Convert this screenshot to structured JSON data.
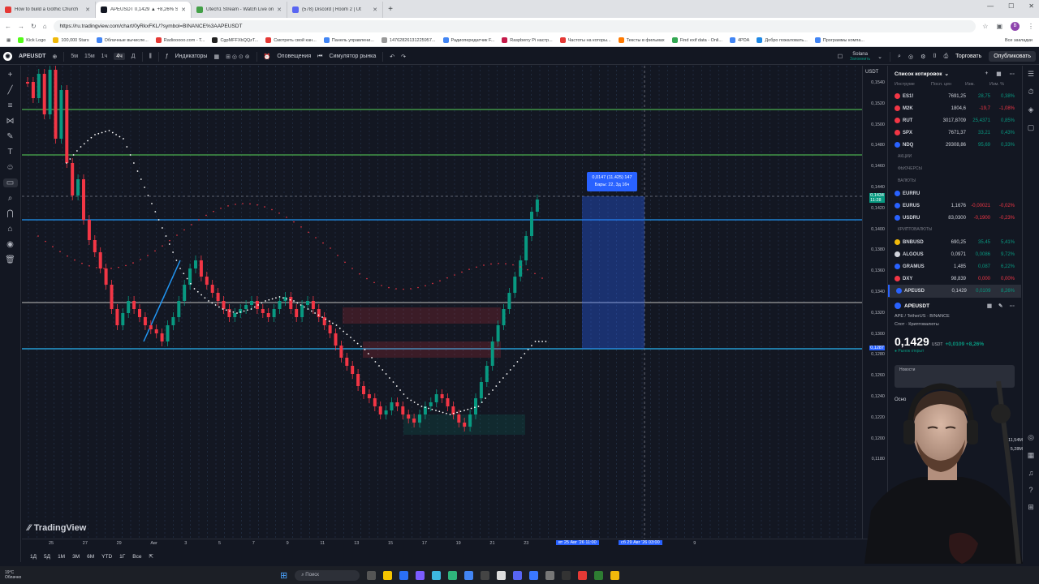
{
  "browser": {
    "tabs": [
      {
        "title": "How to build a Gothic Church",
        "color": "#e53935"
      },
      {
        "title": "APEUSDT 0,1429 ▲ +8,26% Sol",
        "color": "#131722",
        "active": true
      },
      {
        "title": "Utech1 Stream - Watch Live on",
        "color": "#43a047"
      },
      {
        "title": "(578) Discord | Room 2 | Ut",
        "color": "#5865f2"
      }
    ],
    "url": "https://ru.tradingview.com/chart/0yRkxFKL/?symbol=BINANCE%3AAPEUSDT",
    "bookmarks": [
      "Kick Logo",
      "100,000 Stars",
      "Облачные вычисле...",
      "Radiooooo.com - T...",
      "CgpMFFXbQQzT...",
      "Смотреть свой кан...",
      "Панель управлени...",
      "14762826131225957...",
      "Радиопередатчик F...",
      "Raspberry Pi настр...",
      "Частоты на которы...",
      "Тексты в фильмах",
      "Find exif data - Onli...",
      "4PDA",
      "Добро пожаловать...",
      "Программы компа..."
    ],
    "bookmarks_right": "Все закладки"
  },
  "toolbar": {
    "symbol": "APEUSDT",
    "intervals": [
      "5м",
      "15м",
      "1ч",
      "4ч",
      "Д"
    ],
    "indicators": "Индикаторы",
    "alerts": "Оповещения",
    "replay": "Симулятор рынка",
    "solana_name": "Solana",
    "solana_sub": "Запомнить",
    "trade": "Торговать",
    "publish": "Опубликовать"
  },
  "chart": {
    "currency": "USDT",
    "price_labels": [
      "0,1540",
      "0,1520",
      "0,1500",
      "0,1480",
      "0,1460",
      "0,1440",
      "0,1420",
      "0,1400",
      "0,1380",
      "0,1360",
      "0,1340",
      "0,1320",
      "0,1300",
      "0,1280",
      "0,1260",
      "0,1240",
      "0,1220",
      "0,1200",
      "0,1180"
    ],
    "current_price_tag": "0,1434",
    "current_price_sub": "11:28",
    "level_tag": "0,1287",
    "measure_line1": "0,0147 (11,425) 147",
    "measure_line2": "Бары: 22, 3д 16ч",
    "time_labels": [
      "25",
      "27",
      "29",
      "Авг",
      "3",
      "5",
      "7",
      "9",
      "11",
      "13",
      "15",
      "17",
      "19",
      "21",
      "23",
      "Сен",
      "3",
      "5",
      "7",
      "9"
    ],
    "time_box1": "вт 25 Авг '26   11:00",
    "time_box2": "сб 29 Авг '26   03:00",
    "watermark": "TradingView"
  },
  "range_bar": [
    "1Д",
    "5Д",
    "1М",
    "3М",
    "6М",
    "YTD",
    "1Г",
    "Все"
  ],
  "watchlist": {
    "title": "Список котировок",
    "columns": [
      "Инструме",
      "Посл. цен",
      "Изм.",
      "Изм. %"
    ],
    "rows": [
      {
        "sym": "ES1!",
        "price": "7691,25",
        "chg": "28,75",
        "pct": "0,38%",
        "dir": "pos",
        "color": "#f23645"
      },
      {
        "sym": "M2K",
        "price": "1804,6",
        "chg": "-19,7",
        "pct": "-1,08%",
        "dir": "neg",
        "color": "#f23645"
      },
      {
        "sym": "RUT",
        "price": "3017,8709",
        "chg": "25,4371",
        "pct": "0,85%",
        "dir": "pos",
        "color": "#f23645"
      },
      {
        "sym": "SPX",
        "price": "7671,37",
        "chg": "33,21",
        "pct": "0,43%",
        "dir": "pos",
        "color": "#f23645"
      },
      {
        "sym": "NDQ",
        "price": "29308,86",
        "chg": "95,69",
        "pct": "0,33%",
        "dir": "pos",
        "color": "#2962ff"
      }
    ],
    "group_stocks": "Акции",
    "group_futures": "Фьючерсы",
    "group_fx": "Валюты",
    "fx_rows": [
      {
        "sym": "EURRU",
        "price": "",
        "chg": "",
        "pct": "",
        "dir": "neu",
        "color": "#2962ff"
      },
      {
        "sym": "EURUS",
        "price": "1,1676",
        "chg": "-0,00021",
        "pct": "-0,02%",
        "dir": "neg",
        "color": "#2962ff"
      },
      {
        "sym": "USDRU",
        "price": "83,0300",
        "chg": "-0,1900",
        "pct": "-0,23%",
        "dir": "neg",
        "color": "#2962ff"
      }
    ],
    "group_crypto": "Криптовалюты",
    "crypto_rows": [
      {
        "sym": "BNBUSD",
        "price": "690,25",
        "chg": "35,45",
        "pct": "5,41%",
        "dir": "pos",
        "color": "#f0b90b"
      },
      {
        "sym": "ALGOUS",
        "price": "0,0971",
        "chg": "0,0086",
        "pct": "9,72%",
        "dir": "pos",
        "color": "#d1d4dc"
      },
      {
        "sym": "GRAMUS",
        "price": "1,485",
        "chg": "0,087",
        "pct": "6,22%",
        "dir": "pos",
        "color": "#2962ff"
      },
      {
        "sym": "DXY",
        "price": "98,839",
        "chg": "0,000",
        "pct": "0,00%",
        "dir": "neg",
        "color": "#f23645"
      },
      {
        "sym": "APEUSD",
        "price": "0,1429",
        "chg": "0,0109",
        "pct": "8,26%",
        "dir": "pos",
        "color": "#2962ff",
        "selected": true
      }
    ]
  },
  "details": {
    "symbol": "APEUSDT",
    "subtitle": "APE / TetherUS · BINANCE",
    "subtitle2": "Спот · Криптовалюты",
    "price": "0,1429",
    "unit": "USDT",
    "change": "+0,0109 +8,26%",
    "market": "● Рынок открыт",
    "news": "Новости",
    "basic": "Осно",
    "vol1": "11,54M",
    "vol2": "5,28M"
  },
  "taskbar": {
    "weather_temp": "19°C",
    "weather_desc": "Облачно",
    "search": "Поиск"
  }
}
